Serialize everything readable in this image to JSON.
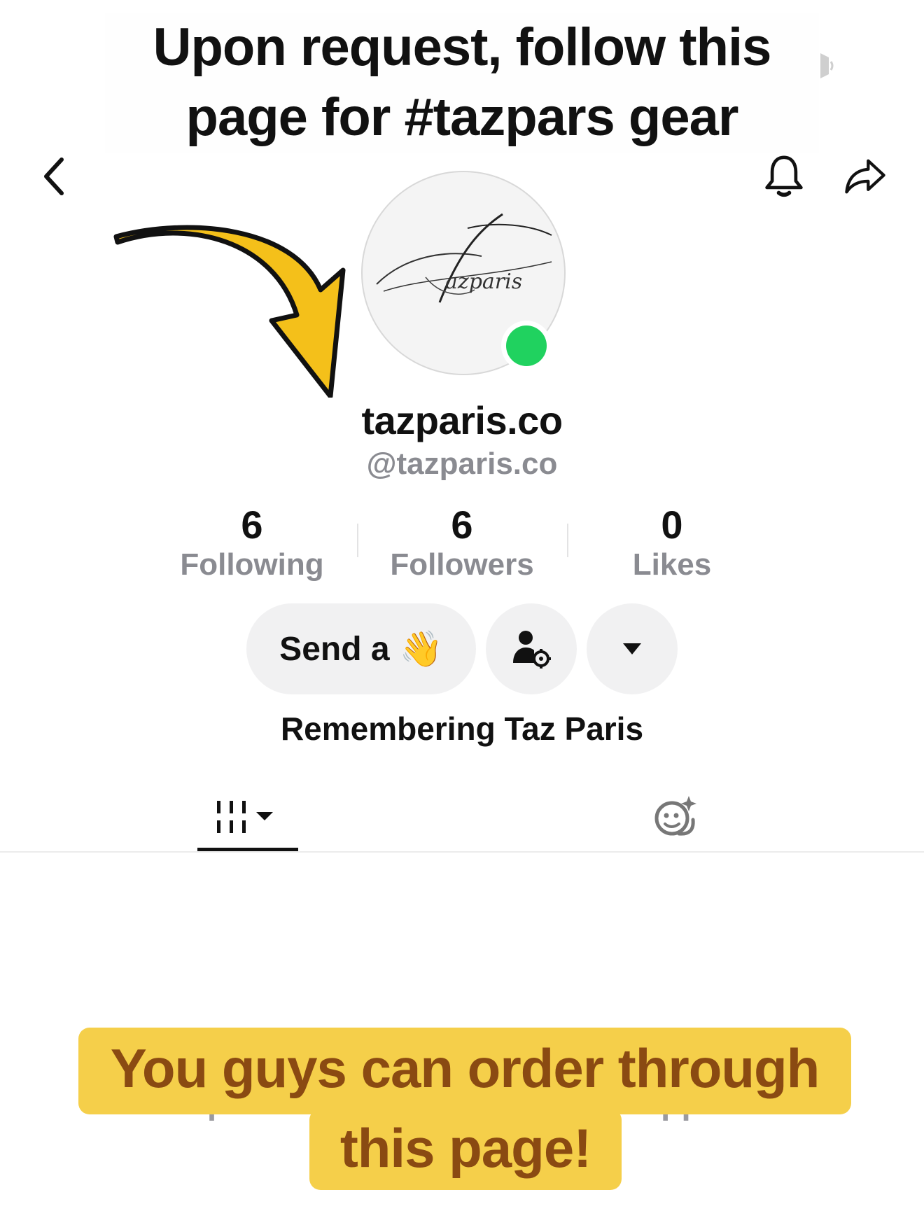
{
  "captions": {
    "top_line_1": "Upon request, follow this",
    "top_line_2": "page for #tazpars gear",
    "bottom_line_1": "You guys can order through",
    "bottom_line_2": "this page!"
  },
  "profile": {
    "display_name": "tazparis.co",
    "handle": "@tazparis.co",
    "bio": "Remembering Taz Paris",
    "online": true
  },
  "stats": {
    "following": {
      "value": "6",
      "label": "Following"
    },
    "followers": {
      "value": "6",
      "label": "Followers"
    },
    "likes": {
      "value": "0",
      "label": "Likes"
    }
  },
  "actions": {
    "wave_label": "Send a",
    "wave_emoji": "👋"
  },
  "empty_state": {
    "text": "videos poste                                     appear here"
  },
  "colors": {
    "online": "#20d25f",
    "caption_bg": "#f5cf4a",
    "caption_text": "#8a4a12",
    "arrow": "#f4c01a"
  },
  "icons": [
    "back-arrow-icon",
    "bell-icon",
    "share-icon",
    "person-settings-icon",
    "dropdown-caret-icon",
    "video-grid-icon",
    "reposts-face-icon"
  ]
}
